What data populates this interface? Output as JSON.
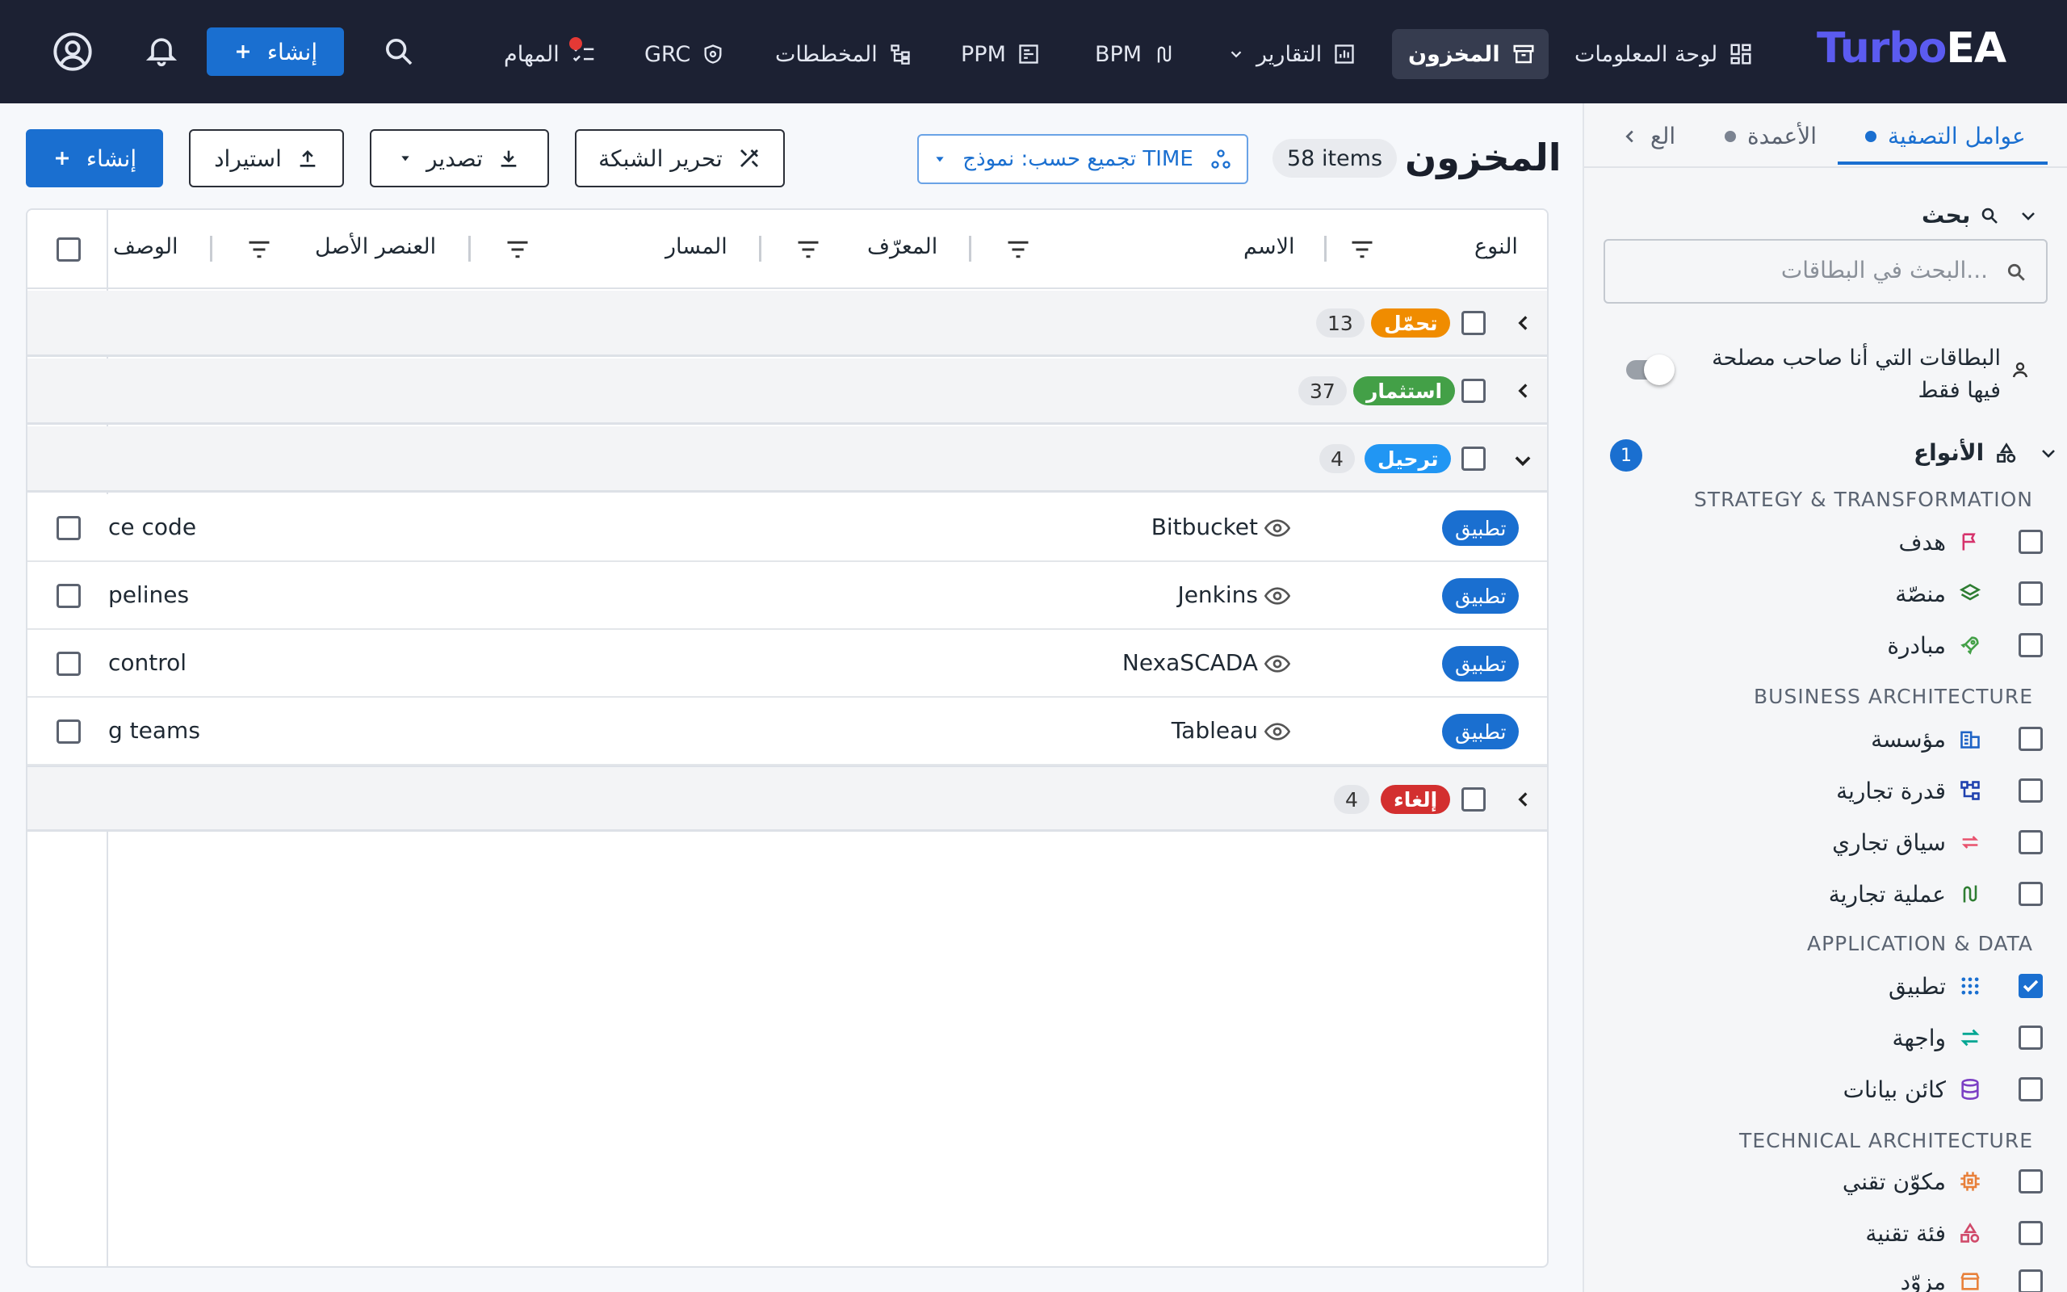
{
  "topbar": {
    "logo_turbo": "Turbo",
    "logo_ea": "EA",
    "nav": {
      "dashboard": "لوحة المعلومات",
      "inventory": "المخزون",
      "reports": "التقارير",
      "bpm": "BPM",
      "ppm": "PPM",
      "diagrams": "المخططات",
      "grc": "GRC",
      "tasks": "المهام"
    },
    "create_label": "إنشاء"
  },
  "toolbar": {
    "page_title": "المخزون",
    "items_count": "58 items",
    "group_by_label": "تجميع حسب: نموذج TIME",
    "edit_grid_label": "تحرير الشبكة",
    "export_label": "تصدير",
    "import_label": "استيراد",
    "create_label": "إنشاء"
  },
  "table": {
    "columns": [
      "النوع",
      "الاسم",
      "المعرّف",
      "المسار",
      "العنصر الأصل",
      "الوصف"
    ],
    "groups": [
      {
        "label": "تحمّل",
        "count": "13",
        "color": "#f08c00"
      },
      {
        "label": "استثمار",
        "count": "37",
        "color": "#43a047"
      },
      {
        "label": "ترحيل",
        "count": "4",
        "color": "#2196f3"
      },
      {
        "label": "إلغاء",
        "count": "4",
        "color": "#d32f2f"
      }
    ],
    "rows": [
      {
        "type": "تطبيق",
        "name": "Bitbucket",
        "description": "ce code"
      },
      {
        "type": "تطبيق",
        "name": "Jenkins",
        "description": "pelines"
      },
      {
        "type": "تطبيق",
        "name": "NexaSCADA",
        "description": "control"
      },
      {
        "type": "تطبيق",
        "name": "Tableau",
        "description": "g teams"
      }
    ]
  },
  "sidebar": {
    "tabs": {
      "filters": "عوامل التصفية",
      "columns": "الأعمدة",
      "more": "الع"
    },
    "search": {
      "title": "بحث",
      "placeholder": "البحث في البطاقات..."
    },
    "stakeholder_toggle": {
      "line1": "البطاقات التي أنا صاحب مصلحة",
      "line2": "فيها فقط"
    },
    "types": {
      "title": "الأنواع",
      "badge": "1",
      "sections": [
        {
          "heading": "STRATEGY & TRANSFORMATION",
          "items": [
            {
              "label": "هدف",
              "icon": "flag-icon",
              "color": "#d6336c",
              "checked": false
            },
            {
              "label": "منصّة",
              "icon": "layers-icon",
              "color": "#2e7d32",
              "checked": false
            },
            {
              "label": "مبادرة",
              "icon": "rocket-icon",
              "color": "#43a047",
              "checked": false
            }
          ]
        },
        {
          "heading": "BUSINESS ARCHITECTURE",
          "items": [
            {
              "label": "مؤسسة",
              "icon": "building-icon",
              "color": "#1e63c6",
              "checked": false
            },
            {
              "label": "قدرة تجارية",
              "icon": "hierarchy-icon",
              "color": "#1e40af",
              "checked": false
            },
            {
              "label": "سياق تجاري",
              "icon": "swap-icon",
              "color": "#e8526e",
              "checked": false
            },
            {
              "label": "عملية تجارية",
              "icon": "route-icon",
              "color": "#2e7d32",
              "checked": false
            }
          ]
        },
        {
          "heading": "APPLICATION & DATA",
          "items": [
            {
              "label": "تطبيق",
              "icon": "apps-grid-icon",
              "color": "#1a6fd0",
              "checked": true
            },
            {
              "label": "واجهة",
              "icon": "exchange-icon",
              "color": "#00a693",
              "checked": false
            },
            {
              "label": "كائن بيانات",
              "icon": "database-icon",
              "color": "#7b3fc4",
              "checked": false
            }
          ]
        },
        {
          "heading": "TECHNICAL ARCHITECTURE",
          "items": [
            {
              "label": "مكوّن تقني",
              "icon": "chip-icon",
              "color": "#e8803a",
              "checked": false
            },
            {
              "label": "فئة تقنية",
              "icon": "shapes-icon",
              "color": "#d04a6a",
              "checked": false
            },
            {
              "label": "مزوّد",
              "icon": "store-icon",
              "color": "#e8803a",
              "checked": false
            }
          ]
        }
      ]
    }
  }
}
